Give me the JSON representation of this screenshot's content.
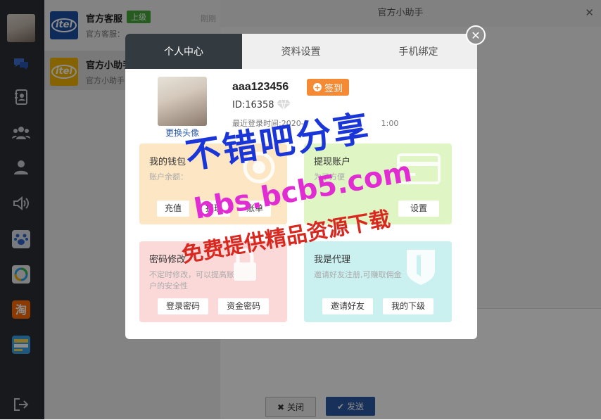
{
  "colors": {
    "rail": "#2b2f36",
    "accent_blue": "#2b5aa6",
    "badge_green": "#48a83c",
    "signin_orange": "#f48a33",
    "wallet_bg": "#fde6c4",
    "withdraw_bg": "#dff5c4",
    "password_bg": "#fcd9d9",
    "agent_bg": "#caf0f0"
  },
  "sidebar": {
    "icons": [
      "chat-icon",
      "contacts-book-icon",
      "group-icon",
      "user-icon",
      "speaker-icon",
      "paw-icon",
      "qq-icon",
      "taobao-icon",
      "wallet-app-icon",
      "logout-icon"
    ]
  },
  "contacts": [
    {
      "name": "官方客服",
      "badge": "上级",
      "time": "刚刚",
      "preview": "官方客服：",
      "logo_text": "itel",
      "logo_color": "#1d4fa3"
    },
    {
      "name": "官方小助手",
      "preview": "官方小助手",
      "logo_text": "itel",
      "logo_color": "#f2b500"
    }
  ],
  "chat": {
    "title": "官方小助手",
    "close_label": "关闭",
    "send_label": "发送"
  },
  "modal": {
    "tabs": [
      "个人中心",
      "资料设置",
      "手机绑定"
    ],
    "active_tab": 0,
    "change_avatar": "更换头像",
    "username": "aaa123456",
    "signin_label": "签到",
    "id_text": "ID:16358",
    "last_login": "最近登录时间:2020-",
    "last_login_tail": "1:00",
    "cards": {
      "wallet": {
        "title": "我的钱包",
        "desc": "账户余额：",
        "buttons": [
          "充值",
          "提现",
          "账单"
        ]
      },
      "withdraw": {
        "title": "提现账户",
        "desc": "为了方便",
        "buttons": [
          "设置"
        ]
      },
      "password": {
        "title": "密码修改",
        "desc": "不定时修改，可以提高账户的安全性",
        "buttons": [
          "登录密码",
          "资金密码"
        ]
      },
      "agent": {
        "title": "我是代理",
        "desc": "邀请好友注册,可赚取佣金",
        "buttons": [
          "邀请好友",
          "我的下级"
        ]
      }
    }
  },
  "watermark": {
    "line1": "不错吧分享",
    "line2": "bbs.bcb5.com",
    "line3": "免费提供精品资源下载"
  }
}
